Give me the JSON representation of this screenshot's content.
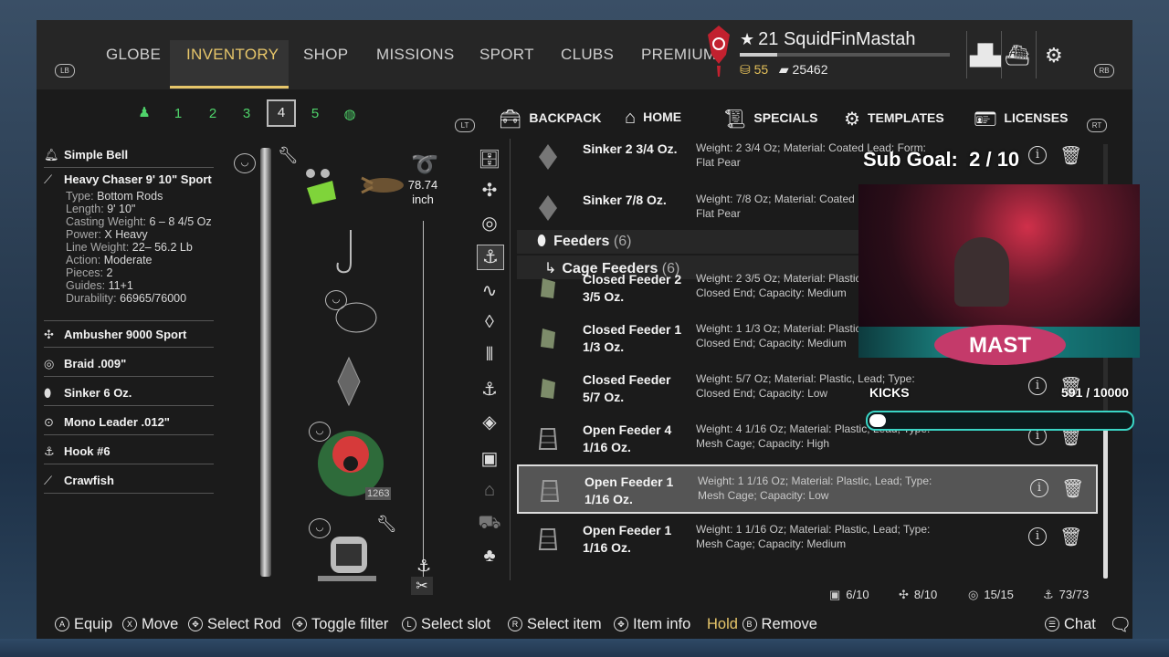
{
  "nav": {
    "lb": "LB",
    "rb": "RB",
    "tabs": [
      "GLOBE",
      "INVENTORY",
      "SHOP",
      "MISSIONS",
      "SPORT",
      "CLUBS",
      "PREMIUM"
    ],
    "active": "INVENTORY"
  },
  "player": {
    "level": "21",
    "name": "SquidFinMastah",
    "gold": "55",
    "silver": "25462"
  },
  "top_icons": [
    "leaderboard-icon",
    "ship-icon",
    "settings-gear-icon"
  ],
  "rod_slots": [
    "1",
    "2",
    "3",
    "4",
    "5"
  ],
  "selected_slot": "4",
  "tackle": {
    "bell": "Simple Bell",
    "rod": "Heavy Chaser 9' 10\" Sport",
    "details": [
      {
        "k": "Type:",
        "v": "Bottom Rods"
      },
      {
        "k": "Length:",
        "v": "9' 10\""
      },
      {
        "k": "Casting Weight:",
        "v": "6 – 8 4/5 Oz"
      },
      {
        "k": "Power:",
        "v": "X Heavy"
      },
      {
        "k": "Line Weight:",
        "v": "22– 56.2 Lb"
      },
      {
        "k": "Action:",
        "v": "Moderate"
      },
      {
        "k": "Pieces:",
        "v": "2"
      },
      {
        "k": "Guides:",
        "v": "11+1"
      },
      {
        "k": "Durability:",
        "v": "66965/76000"
      }
    ],
    "reel": "Ambusher 9000 Sport",
    "line": "Braid .009\"",
    "sinker": "Sinker 6 Oz.",
    "leader": "Mono Leader .012\"",
    "hook": "Hook #6",
    "bait": "Crawfish"
  },
  "line_length": {
    "value": "78.74",
    "unit": "inch"
  },
  "spool_count": "1263",
  "right_tabs": {
    "lt": "LT",
    "rt": "RT",
    "items": [
      "BACKPACK",
      "HOME",
      "SPECIALS",
      "TEMPLATES",
      "LICENSES"
    ]
  },
  "items_top": [
    {
      "name": "Sinker 2 3/4 Oz.",
      "desc": "Weight: 2 3/4 Oz; Material: Coated Lead; Form: Flat Pear"
    },
    {
      "name": "Sinker 7/8 Oz.",
      "desc": "Weight: 7/8 Oz; Material: Coated Lead; Form: Flat Pear"
    }
  ],
  "category": {
    "name": "Feeders",
    "count": "(6)"
  },
  "subcategory": {
    "arrow": "↳",
    "name": "Cage Feeders",
    "count": "(6)"
  },
  "items": [
    {
      "name": "Closed Feeder 2 3/5 Oz.",
      "desc": "Weight: 2 3/5 Oz; Material: Plastic, Lead; Type: Closed End; Capacity: Medium"
    },
    {
      "name": "Closed Feeder 1 1/3 Oz.",
      "desc": "Weight: 1 1/3 Oz; Material: Plastic, Lead; Type: Closed End; Capacity: Medium"
    },
    {
      "name": "Closed Feeder 5/7 Oz.",
      "desc": "Weight: 5/7 Oz; Material: Plastic, Lead; Type: Closed End; Capacity: Low"
    },
    {
      "name": "Open Feeder 4 1/16 Oz.",
      "desc": "Weight: 4 1/16 Oz; Material: Plastic, Lead; Type: Mesh Cage; Capacity: High"
    },
    {
      "name": "Open Feeder 1 1/16 Oz.",
      "desc": "Weight: 1 1/16 Oz; Material: Plastic, Lead; Type: Mesh Cage; Capacity: Low"
    },
    {
      "name": "Open Feeder 1 1/16 Oz.",
      "desc": "Weight: 1 1/16 Oz; Material: Plastic, Lead; Type: Mesh Cage; Capacity: Medium"
    }
  ],
  "selected_item_index": 4,
  "capacity": [
    {
      "icon": "backpack-icon",
      "value": "6/10"
    },
    {
      "icon": "rod-icon",
      "value": "8/10"
    },
    {
      "icon": "spool-icon",
      "value": "15/15"
    },
    {
      "icon": "bait-icon",
      "value": "73/73"
    }
  ],
  "stream_overlay": {
    "sub_goal_label": "Sub Goal:",
    "sub_goal_value": "2 / 10",
    "kicks_label": "KICKS",
    "kicks_value": "591",
    "kicks_total": "/ 10000",
    "kicks_progress": 0.0591,
    "logo_text": "MAST"
  },
  "hints": [
    {
      "btn": "A",
      "label": "Equip"
    },
    {
      "btn": "X",
      "label": "Move"
    },
    {
      "btn": "✥",
      "label": "Select Rod"
    },
    {
      "btn": "✥",
      "label": "Toggle filter"
    },
    {
      "btn": "L",
      "label": "Select slot"
    },
    {
      "btn": "R",
      "label": "Select item"
    },
    {
      "btn": "✥",
      "label": "Item info"
    },
    {
      "btn": "B",
      "label": "Remove",
      "prefix": "Hold"
    }
  ],
  "chat": "Chat",
  "colors": {
    "accent": "#e7c66a",
    "green": "#4fd36a",
    "teal": "#3ad6c6"
  }
}
